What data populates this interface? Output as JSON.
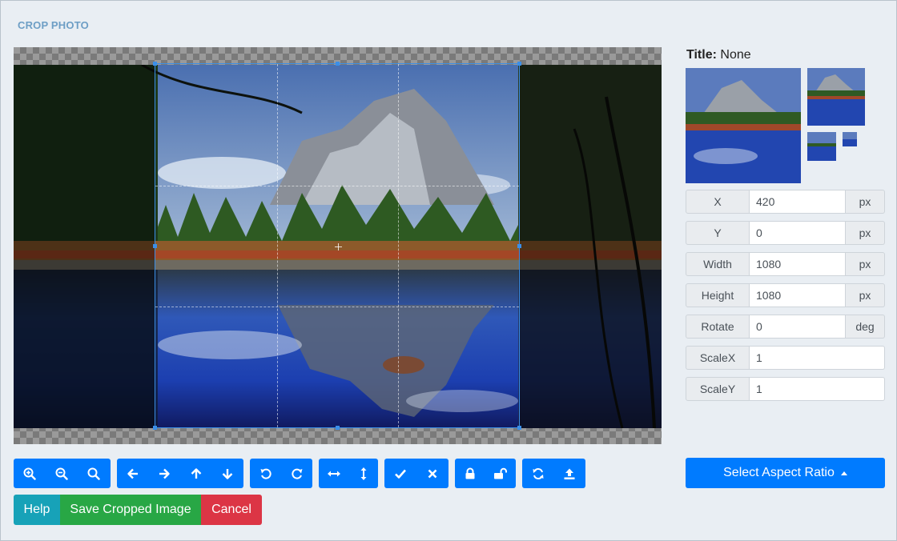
{
  "page": {
    "title": "CROP PHOTO"
  },
  "image_info": {
    "title_label": "Title:",
    "title_value": "None"
  },
  "fields": [
    {
      "label": "X",
      "value": "420",
      "unit": "px"
    },
    {
      "label": "Y",
      "value": "0",
      "unit": "px"
    },
    {
      "label": "Width",
      "value": "1080",
      "unit": "px"
    },
    {
      "label": "Height",
      "value": "1080",
      "unit": "px"
    },
    {
      "label": "Rotate",
      "value": "0",
      "unit": "deg"
    },
    {
      "label": "ScaleX",
      "value": "1",
      "unit": ""
    },
    {
      "label": "ScaleY",
      "value": "1",
      "unit": ""
    }
  ],
  "aspect_ratio_button": {
    "label": "Select Aspect Ratio"
  },
  "toolbar_icons": [
    "zoom-in-icon",
    "zoom-out-icon",
    "zoom-reset-icon",
    "arrow-left-icon",
    "arrow-right-icon",
    "arrow-up-icon",
    "arrow-down-icon",
    "rotate-left-icon",
    "rotate-right-icon",
    "flip-horizontal-icon",
    "flip-vertical-icon",
    "check-icon",
    "close-icon",
    "lock-icon",
    "unlock-icon",
    "refresh-icon",
    "upload-icon"
  ],
  "actions": {
    "help": "Help",
    "save": "Save Cropped Image",
    "cancel": "Cancel"
  },
  "colors": {
    "primary": "#007bff",
    "info": "#17a2b8",
    "success": "#28a745",
    "danger": "#dc3545",
    "crop_border": "#3b8fe8"
  }
}
